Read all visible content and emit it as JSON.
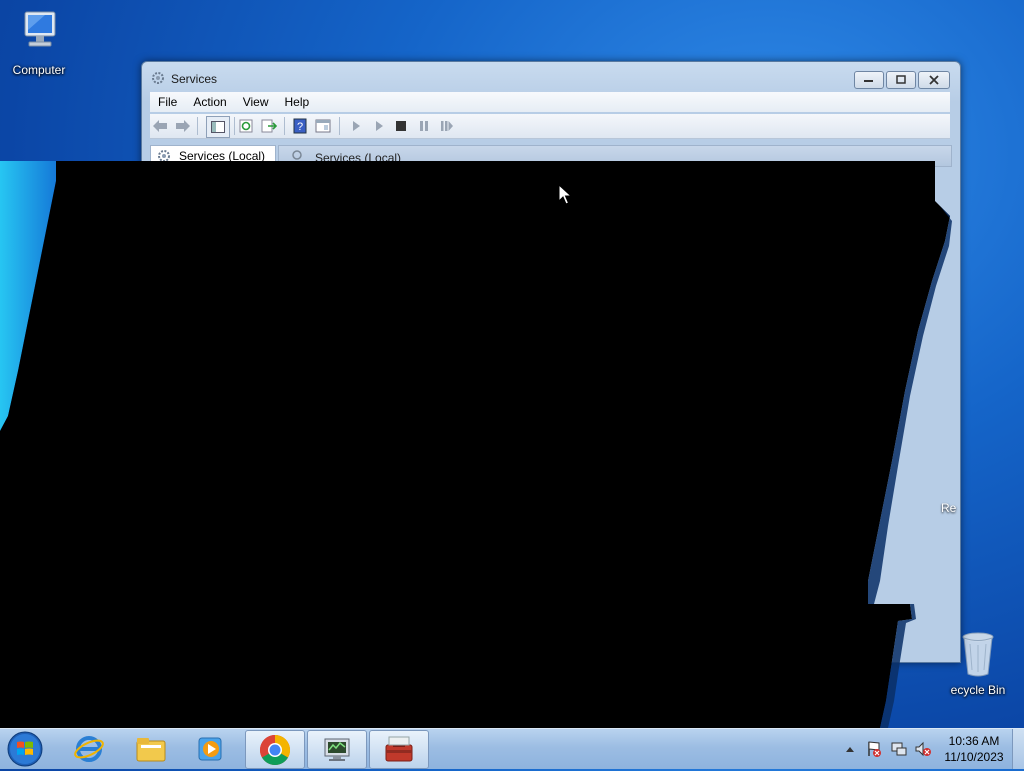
{
  "desktop": {
    "icons": [
      {
        "label": "Computer",
        "icon": "computer-icon"
      },
      {
        "label": "ecycle Bin",
        "icon": "recycle-bin-icon"
      }
    ],
    "partial_text": "Re"
  },
  "window": {
    "title": "Services",
    "menu": [
      "File",
      "Action",
      "View",
      "Help"
    ],
    "toolbar_icons": [
      "back-icon",
      "forward-icon",
      "show-hide-console-tree-icon",
      "refresh-icon",
      "export-list-icon",
      "help-icon",
      "properties-icon",
      "start-service-icon",
      "start-service-alt-icon",
      "stop-service-icon",
      "pause-service-icon",
      "restart-service-icon"
    ],
    "left_pane_label": "Services (Local)",
    "right_pane_label": "Services (Local)"
  },
  "taskbar": {
    "apps": [
      "internet-explorer-icon",
      "file-explorer-icon",
      "media-player-icon",
      "chrome-icon",
      "network-monitor-icon",
      "toolbox-icon"
    ],
    "active_app": "chrome-icon",
    "tray_icons": [
      "show-hidden-icons-arrow",
      "action-center-flag-icon",
      "network-icon",
      "volume-muted-icon"
    ],
    "time": "10:36 AM",
    "date": "11/10/2023"
  },
  "colors": {
    "desktop_bg": "#1565c9",
    "taskbar": "#9cbde3",
    "window_frame": "#b7cde6"
  }
}
